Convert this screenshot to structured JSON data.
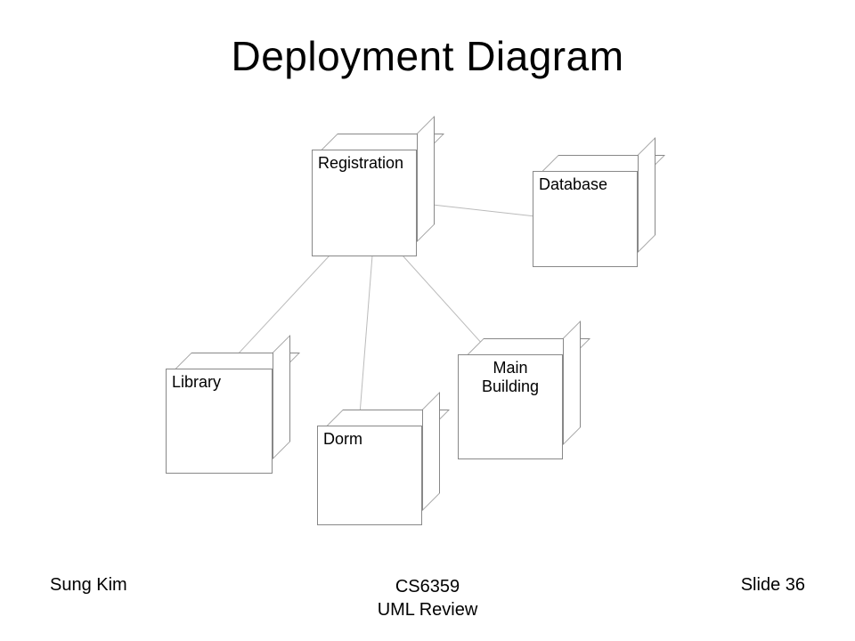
{
  "title": "Deployment Diagram",
  "nodes": {
    "registration": {
      "label": "Registration"
    },
    "database": {
      "label": "Database"
    },
    "library": {
      "label": "Library"
    },
    "dorm": {
      "label": "Dorm"
    },
    "main_building": {
      "label": "Main\nBuilding"
    }
  },
  "footer": {
    "author": "Sung Kim",
    "course": "CS6359\nUML Review",
    "slide": "Slide 36"
  }
}
